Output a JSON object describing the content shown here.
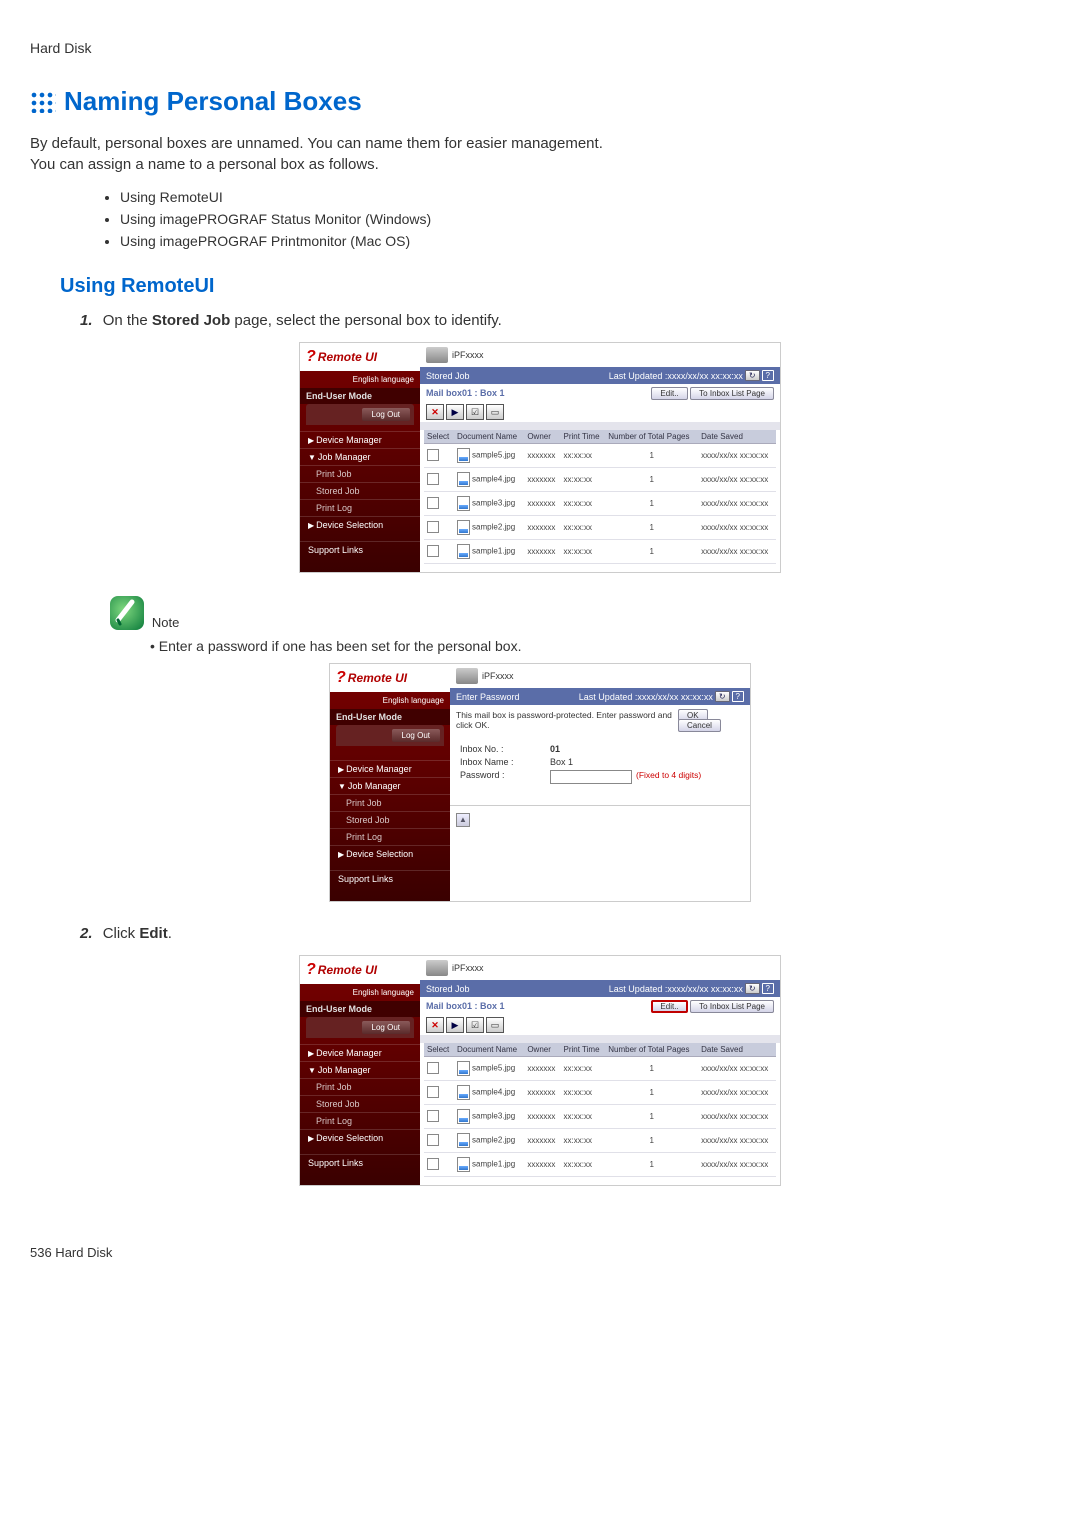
{
  "breadcrumb": "Hard Disk",
  "page_title": "Naming Personal Boxes",
  "intro_line1": "By default, personal boxes are unnamed. You can name them for easier management.",
  "intro_line2": "You can assign a name to a personal box as follows.",
  "methods": [
    "Using RemoteUI",
    "Using imagePROGRAF Status Monitor (Windows)",
    "Using imagePROGRAF Printmonitor (Mac OS)"
  ],
  "section_title": "Using RemoteUI",
  "step1_pre": "On the ",
  "step1_bold": "Stored Job",
  "step1_post": " page, select the personal box to identify.",
  "note_label": "Note",
  "note_bullet": "Enter a password if one has been set for the personal box.",
  "step2_pre": "Click ",
  "step2_bold": "Edit",
  "step2_post": ".",
  "footer": "536  Hard Disk",
  "remoteui": {
    "logo": "Remote UI",
    "lang": "English language",
    "cat_enduser": "End-User Mode",
    "logout": "Log Out",
    "nav": {
      "device_manager": "Device Manager",
      "job_manager": "Job Manager",
      "print_job": "Print Job",
      "stored_job": "Stored Job",
      "print_log": "Print Log",
      "device_selection": "Device Selection",
      "support_links": "Support Links"
    },
    "printer_model": "iPFxxxx",
    "bluebar_title_stored": "Stored Job",
    "bluebar_title_pw": "Enter Password",
    "last_updated": "Last Updated :xxxx/xx/xx xx:xx:xx",
    "mailbox_path": "Mail box01 : Box 1",
    "edit_btn": "Edit..",
    "to_inbox_btn": "To Inbox List Page",
    "columns": {
      "select": "Select",
      "document_name": "Document Name",
      "owner": "Owner",
      "print_time": "Print Time",
      "pages": "Number of Total Pages",
      "date_saved": "Date Saved"
    },
    "rows": [
      {
        "name": "sample5.jpg",
        "owner": "xxxxxxx",
        "time": "xx:xx:xx",
        "pages": "1",
        "date": "xxxx/xx/xx xx:xx:xx"
      },
      {
        "name": "sample4.jpg",
        "owner": "xxxxxxx",
        "time": "xx:xx:xx",
        "pages": "1",
        "date": "xxxx/xx/xx xx:xx:xx"
      },
      {
        "name": "sample3.jpg",
        "owner": "xxxxxxx",
        "time": "xx:xx:xx",
        "pages": "1",
        "date": "xxxx/xx/xx xx:xx:xx"
      },
      {
        "name": "sample2.jpg",
        "owner": "xxxxxxx",
        "time": "xx:xx:xx",
        "pages": "1",
        "date": "xxxx/xx/xx xx:xx:xx"
      },
      {
        "name": "sample1.jpg",
        "owner": "xxxxxxx",
        "time": "xx:xx:xx",
        "pages": "1",
        "date": "xxxx/xx/xx xx:xx:xx"
      }
    ],
    "pw": {
      "msg": "This mail box is password-protected. Enter password and click OK.",
      "ok": "OK",
      "cancel": "Cancel",
      "inbox_no_label": "Inbox No. :",
      "inbox_no": "01",
      "inbox_name_label": "Inbox Name :",
      "inbox_name": "Box 1",
      "password_label": "Password :",
      "fixed_note": "(Fixed to 4 digits)"
    }
  }
}
